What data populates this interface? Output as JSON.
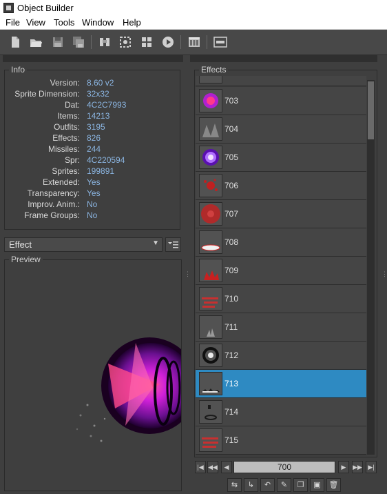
{
  "window": {
    "title": "Object Builder"
  },
  "menu": {
    "items": [
      "File",
      "View",
      "Tools",
      "Window",
      "Help"
    ]
  },
  "toolbar": {
    "icons": [
      "new-file-icon",
      "open-folder-icon",
      "save-icon",
      "save-as-icon",
      "find-icon",
      "select-icon",
      "grid-icon",
      "play-icon",
      "library-icon",
      "log-icon"
    ]
  },
  "info": {
    "title": "Info",
    "rows": [
      {
        "key": "Version:",
        "value": "8.60 v2"
      },
      {
        "key": "Sprite Dimension:",
        "value": "32x32"
      },
      {
        "key": "Dat:",
        "value": "4C2C7993"
      },
      {
        "key": "Items:",
        "value": "14213"
      },
      {
        "key": "Outfits:",
        "value": "3195"
      },
      {
        "key": "Effects:",
        "value": "826"
      },
      {
        "key": "Missiles:",
        "value": "244"
      },
      {
        "key": "Spr:",
        "value": "4C220594"
      },
      {
        "key": "Sprites:",
        "value": "199891"
      },
      {
        "key": "Extended:",
        "value": "Yes"
      },
      {
        "key": "Transparency:",
        "value": "Yes"
      },
      {
        "key": "Improv. Anim.:",
        "value": "No"
      },
      {
        "key": "Frame Groups:",
        "value": "No"
      }
    ]
  },
  "category": {
    "selected": "Effect"
  },
  "preview": {
    "title": "Preview"
  },
  "effects": {
    "title": "Effects",
    "items": [
      {
        "id": "703",
        "color": "#b020d0"
      },
      {
        "id": "704",
        "color": "#909090"
      },
      {
        "id": "705",
        "color": "#9a40f0"
      },
      {
        "id": "706",
        "color": "#c02020"
      },
      {
        "id": "707",
        "color": "#b02a2a"
      },
      {
        "id": "708",
        "color": "#f0f0f0"
      },
      {
        "id": "709",
        "color": "#c82020"
      },
      {
        "id": "710",
        "color": "#c83030"
      },
      {
        "id": "711",
        "color": "#9a9a9a"
      },
      {
        "id": "712",
        "color": "#1a1a1a"
      },
      {
        "id": "713",
        "color": "#202020",
        "selected": true
      },
      {
        "id": "714",
        "color": "#1a1a1a"
      },
      {
        "id": "715",
        "color": "#c83030"
      }
    ]
  },
  "pager": {
    "value": "700"
  },
  "colors": {
    "selection": "#2e8ac2",
    "panel": "#3f3f3f",
    "value_text": "#8ab4e0"
  }
}
